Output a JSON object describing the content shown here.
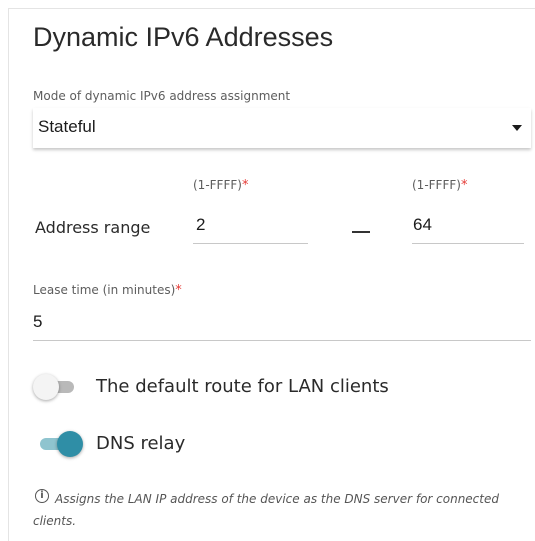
{
  "header": {
    "title": "Dynamic IPv6 Addresses"
  },
  "mode": {
    "label": "Mode of dynamic IPv6 address assignment",
    "value": "Stateful"
  },
  "address_range": {
    "label": "Address range",
    "start": {
      "hint": "(1-FFFF)",
      "required_mark": "*",
      "value": "2"
    },
    "end": {
      "hint": "(1-FFFF)",
      "required_mark": "*",
      "value": "64"
    }
  },
  "lease_time": {
    "label": "Lease time (in minutes)",
    "required_mark": "*",
    "value": "5"
  },
  "default_route": {
    "label": "The default route for LAN clients",
    "enabled": false
  },
  "dns_relay": {
    "label": "DNS relay",
    "enabled": true,
    "hint": "Assigns the LAN IP address of the device as the DNS server for connected clients."
  },
  "colors": {
    "accent": "#2f8ea6",
    "required": "#e53935"
  }
}
